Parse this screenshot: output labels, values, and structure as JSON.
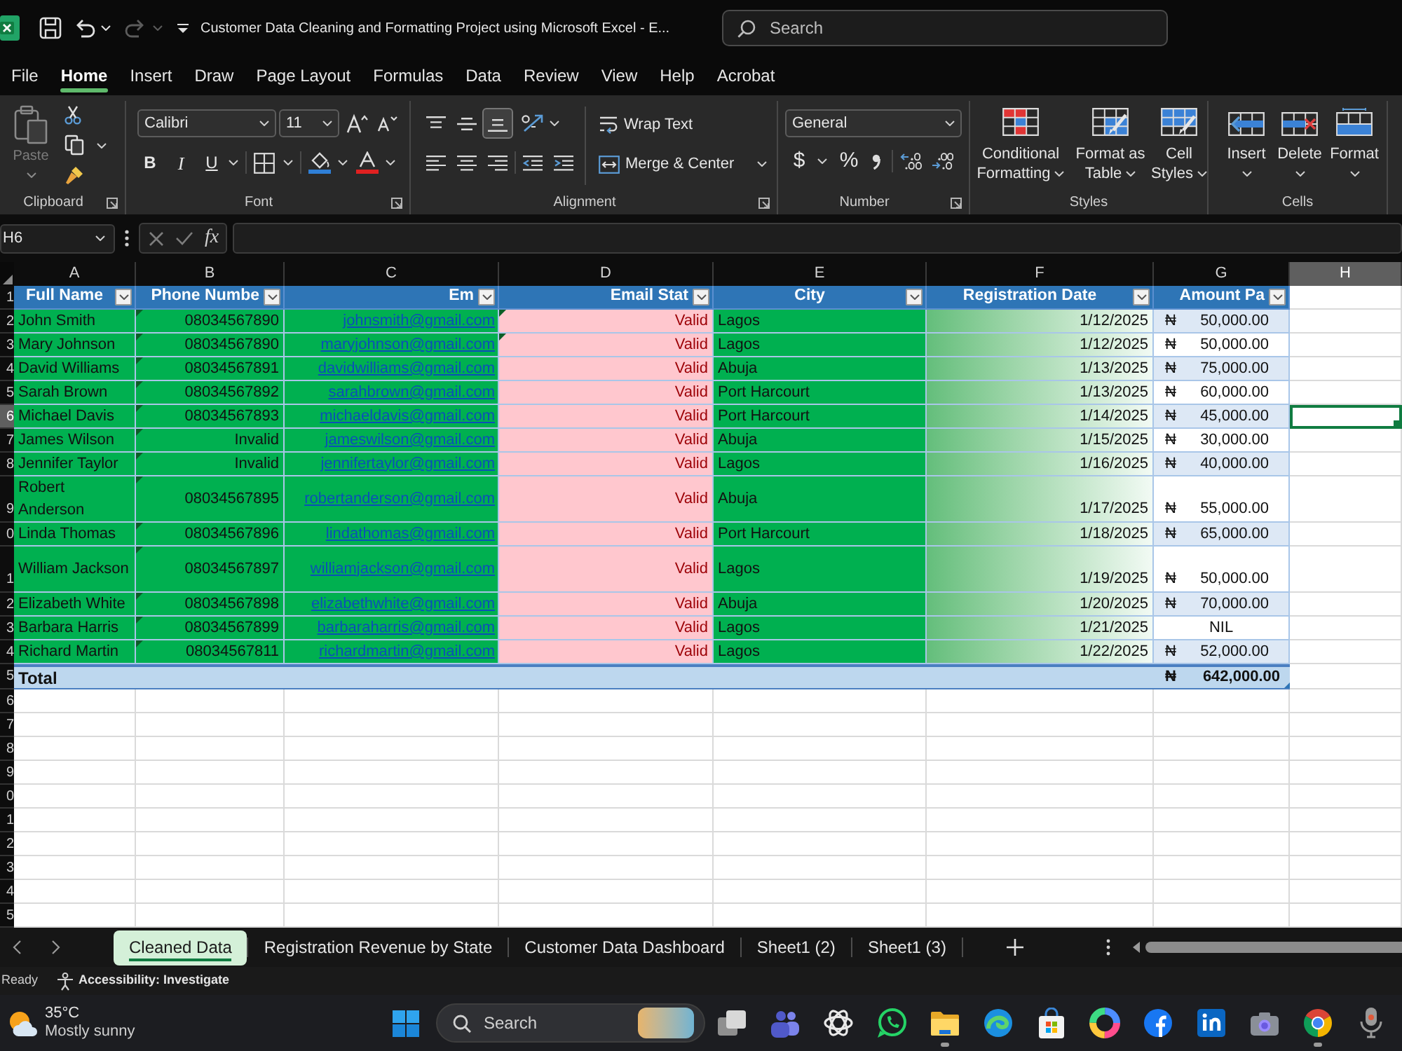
{
  "title_bar": {
    "quick_access": [
      {
        "kind": "save",
        "disabled": false
      },
      {
        "kind": "undo",
        "disabled": false
      },
      {
        "kind": "redo",
        "disabled": true
      },
      {
        "kind": "customize",
        "disabled": false
      }
    ],
    "title": "Customer Data Cleaning and Formatting Project using Microsoft Excel - E...",
    "search": {
      "placeholder": "Search"
    }
  },
  "menu_tabs": [
    {
      "label": "File",
      "selected": false
    },
    {
      "label": "Home",
      "selected": true
    },
    {
      "label": "Insert",
      "selected": false
    },
    {
      "label": "Draw",
      "selected": false
    },
    {
      "label": "Page Layout",
      "selected": false
    },
    {
      "label": "Formulas",
      "selected": false
    },
    {
      "label": "Data",
      "selected": false
    },
    {
      "label": "Review",
      "selected": false
    },
    {
      "label": "View",
      "selected": false
    },
    {
      "label": "Help",
      "selected": false
    },
    {
      "label": "Acrobat",
      "selected": false
    }
  ],
  "ribbon": {
    "clipboard": {
      "label": "Clipboard",
      "paste": {
        "label": "Paste",
        "disabled": true
      }
    },
    "font": {
      "label": "Font",
      "font_name": "Calibri",
      "font_size": "11",
      "bold": "B",
      "italic": "I",
      "underline": "U"
    },
    "alignment": {
      "label": "Alignment",
      "vertical_align": [
        {
          "kind": "top",
          "selected": false
        },
        {
          "kind": "middle",
          "selected": false
        },
        {
          "kind": "bottom",
          "selected": true
        }
      ],
      "wrap_text": "Wrap Text",
      "merge_center": "Merge & Center"
    },
    "number": {
      "label": "Number",
      "format": "General",
      "currency": "$",
      "percent": "%"
    },
    "styles": {
      "label": "Styles",
      "buttons": [
        {
          "kind": "conditional",
          "label": "Conditional Formatting"
        },
        {
          "kind": "table",
          "label": "Format as Table"
        },
        {
          "kind": "cell_styles",
          "label": "Cell Styles"
        }
      ]
    },
    "cells": {
      "label": "Cells",
      "buttons": [
        {
          "kind": "insert",
          "label": "Insert"
        },
        {
          "kind": "delete",
          "label": "Delete"
        },
        {
          "kind": "format",
          "label": "Format"
        }
      ]
    }
  },
  "formula_bar": {
    "name_box": "H6",
    "function_label": "fx"
  },
  "sheet": {
    "column_headers": [
      {
        "label": "A",
        "selected": false
      },
      {
        "label": "B",
        "selected": false
      },
      {
        "label": "C",
        "selected": false
      },
      {
        "label": "D",
        "selected": false
      },
      {
        "label": "E",
        "selected": false
      },
      {
        "label": "F",
        "selected": false
      },
      {
        "label": "G",
        "selected": false
      },
      {
        "label": "H",
        "selected": true
      }
    ],
    "table_header": {
      "row_number": "1",
      "selected": false,
      "columns": [
        {
          "kind": "name",
          "label": "Full Name"
        },
        {
          "kind": "phone",
          "label": "Phone Numbe"
        },
        {
          "kind": "email",
          "label": "Em"
        },
        {
          "kind": "status",
          "label": "Email Stat"
        },
        {
          "kind": "city",
          "label": "City"
        },
        {
          "kind": "date",
          "label": "Registration Date"
        },
        {
          "kind": "amount",
          "label": "Amount Pa"
        }
      ]
    },
    "rows": [
      {
        "row_number": "2",
        "selected": false,
        "tall": false,
        "name": "John Smith",
        "phone": "08034567890",
        "phone_flagged": true,
        "email": "johnsmith@gmail.com",
        "status": "Valid",
        "status_flagged": true,
        "city": "Lagos",
        "date": "1/12/2025",
        "currency": "₦",
        "amount": "50,000.00"
      },
      {
        "row_number": "3",
        "selected": false,
        "tall": false,
        "name": "Mary Johnson",
        "phone": "08034567890",
        "phone_flagged": true,
        "email": "maryjohnson@gmail.com",
        "status": "Valid",
        "status_flagged": true,
        "city": "Lagos",
        "date": "1/12/2025",
        "currency": "₦",
        "amount": "50,000.00"
      },
      {
        "row_number": "4",
        "selected": false,
        "tall": false,
        "name": "David Williams",
        "phone": "08034567891",
        "phone_flagged": true,
        "email": "davidwilliams@gmail.com",
        "status": "Valid",
        "status_flagged": false,
        "city": "Abuja",
        "date": "1/13/2025",
        "currency": "₦",
        "amount": "75,000.00"
      },
      {
        "row_number": "5",
        "selected": false,
        "tall": false,
        "name": "Sarah Brown",
        "phone": "08034567892",
        "phone_flagged": true,
        "email": "sarahbrown@gmail.com",
        "status": "Valid",
        "status_flagged": false,
        "city": "Port Harcourt",
        "date": "1/13/2025",
        "currency": "₦",
        "amount": "60,000.00"
      },
      {
        "row_number": "6",
        "selected": true,
        "tall": false,
        "name": "Michael Davis",
        "phone": "08034567893",
        "phone_flagged": true,
        "email": "michaeldavis@gmail.com",
        "status": "Valid",
        "status_flagged": false,
        "city": "Port Harcourt",
        "date": "1/14/2025",
        "currency": "₦",
        "amount": "45,000.00"
      },
      {
        "row_number": "7",
        "selected": false,
        "tall": false,
        "name": "James Wilson",
        "phone": "Invalid",
        "phone_flagged": true,
        "email": "jameswilson@gmail.com",
        "status": "Valid",
        "status_flagged": false,
        "city": "Abuja",
        "date": "1/15/2025",
        "currency": "₦",
        "amount": "30,000.00"
      },
      {
        "row_number": "8",
        "selected": false,
        "tall": false,
        "name": "Jennifer Taylor",
        "phone": "Invalid",
        "phone_flagged": true,
        "email": "jennifertaylor@gmail.com",
        "status": "Valid",
        "status_flagged": false,
        "city": "Lagos",
        "date": "1/16/2025",
        "currency": "₦",
        "amount": "40,000.00"
      },
      {
        "row_number": "9",
        "selected": false,
        "tall": true,
        "name": "Robert Anderson",
        "phone": "08034567895",
        "phone_flagged": true,
        "email": "robertanderson@gmail.com",
        "status": "Valid",
        "status_flagged": false,
        "city": "Abuja",
        "date": "1/17/2025",
        "currency": "₦",
        "amount": "55,000.00"
      },
      {
        "row_number": "0",
        "selected": false,
        "tall": false,
        "name": "Linda Thomas",
        "phone": "08034567896",
        "phone_flagged": true,
        "email": "lindathomas@gmail.com",
        "status": "Valid",
        "status_flagged": false,
        "city": "Port Harcourt",
        "date": "1/18/2025",
        "currency": "₦",
        "amount": "65,000.00"
      },
      {
        "row_number": "1",
        "selected": false,
        "tall": true,
        "name": "William Jackson",
        "phone": "08034567897",
        "phone_flagged": true,
        "email": "williamjackson@gmail.com",
        "status": "Valid",
        "status_flagged": false,
        "city": "Lagos",
        "date": "1/19/2025",
        "currency": "₦",
        "amount": "50,000.00"
      },
      {
        "row_number": "2",
        "selected": false,
        "tall": false,
        "name": "Elizabeth White",
        "phone": "08034567898",
        "phone_flagged": true,
        "email": "elizabethwhite@gmail.com",
        "status": "Valid",
        "status_flagged": false,
        "city": "Abuja",
        "date": "1/20/2025",
        "currency": "₦",
        "amount": "70,000.00"
      },
      {
        "row_number": "3",
        "selected": false,
        "tall": false,
        "name": "Barbara Harris",
        "phone": "08034567899",
        "phone_flagged": true,
        "email": "barbaraharris@gmail.com",
        "status": "Valid",
        "status_flagged": false,
        "city": "Lagos",
        "date": "1/21/2025",
        "amount": "NIL"
      },
      {
        "row_number": "4",
        "selected": false,
        "tall": false,
        "name": "Richard Martin",
        "phone": "08034567811",
        "phone_flagged": true,
        "email": "richardmartin@gmail.com",
        "status": "Valid",
        "status_flagged": false,
        "city": "Lagos",
        "date": "1/22/2025",
        "currency": "₦",
        "amount": "52,000.00"
      }
    ],
    "total": {
      "row_number": "5",
      "selected": false,
      "label": "Total",
      "currency": "₦",
      "amount": "642,000.00"
    },
    "empty_rows": [
      {
        "row_number": "6",
        "selected": false
      },
      {
        "row_number": "7",
        "selected": false
      },
      {
        "row_number": "8",
        "selected": false
      },
      {
        "row_number": "9",
        "selected": false
      },
      {
        "row_number": "0",
        "selected": false
      },
      {
        "row_number": "1",
        "selected": false
      },
      {
        "row_number": "2",
        "selected": false
      },
      {
        "row_number": "3",
        "selected": false
      },
      {
        "row_number": "4",
        "selected": false
      },
      {
        "row_number": "5",
        "selected": false
      }
    ]
  },
  "sheet_tabs": [
    {
      "label": "Cleaned Data",
      "selected": true
    },
    {
      "label": "Registration Revenue by State",
      "selected": false
    },
    {
      "label": "Customer Data Dashboard",
      "selected": false
    },
    {
      "label": "Sheet1 (2)",
      "selected": false
    },
    {
      "label": "Sheet1 (3)",
      "selected": false
    }
  ],
  "status_bar": {
    "status": "Ready",
    "accessibility": "Accessibility: Investigate"
  },
  "taskbar": {
    "weather": {
      "temperature": "35°C",
      "condition": "Mostly sunny"
    },
    "search": {
      "placeholder": "Search"
    },
    "apps": [
      {
        "kind": "task_view",
        "running": false
      },
      {
        "kind": "people",
        "running": false
      },
      {
        "kind": "atom",
        "running": false
      },
      {
        "kind": "chat_phone",
        "running": false
      },
      {
        "kind": "folder",
        "running": true
      },
      {
        "kind": "swirl",
        "running": false
      },
      {
        "kind": "bag",
        "running": false
      },
      {
        "kind": "color_ring",
        "running": false
      },
      {
        "kind": "circle_f",
        "running": false
      },
      {
        "kind": "square_in",
        "running": false
      },
      {
        "kind": "camera",
        "running": false
      },
      {
        "kind": "segmented_circle",
        "running": true
      },
      {
        "kind": "microphone",
        "running": false
      }
    ]
  }
}
